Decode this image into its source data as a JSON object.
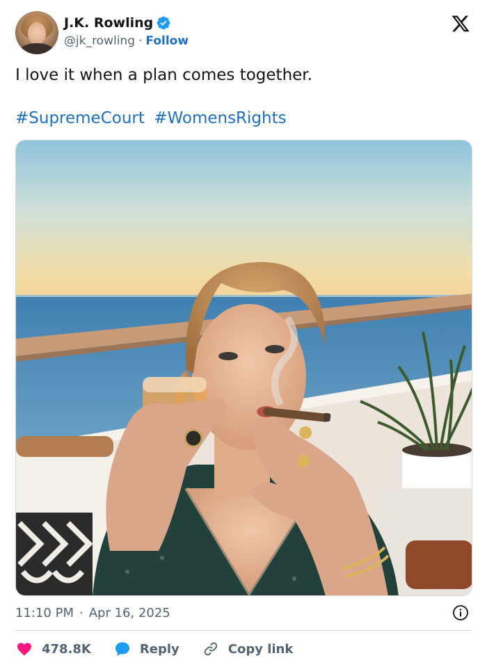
{
  "author": {
    "name": "J.K. Rowling",
    "handle": "@jk_rowling",
    "separator": "·",
    "follow_label": "Follow"
  },
  "tweet": {
    "text": "I love it when a plan comes together.",
    "hashtags": [
      "#SupremeCourt",
      "#WomensRights"
    ]
  },
  "meta": {
    "time": "11:10 PM",
    "separator": "·",
    "date": "Apr 16, 2025"
  },
  "actions": {
    "likes": "478.8K",
    "reply_label": "Reply",
    "copy_link_label": "Copy link"
  },
  "icons": {
    "verified": "verified-badge-icon",
    "x_logo": "x-logo-icon",
    "info": "info-icon",
    "heart": "heart-icon",
    "reply": "reply-bubble-icon",
    "link": "link-icon"
  },
  "colors": {
    "accent": "#1d6fc4",
    "verified": "#1d9bf0",
    "like": "#f91880",
    "muted": "#536471"
  }
}
